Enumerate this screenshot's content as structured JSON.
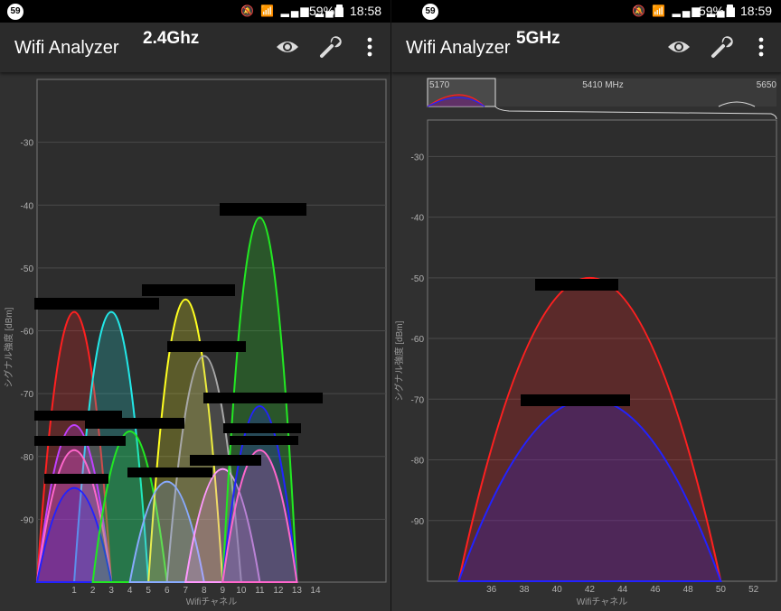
{
  "panels": [
    {
      "status": {
        "badge": "59",
        "battery": "59%",
        "time": "18:58"
      },
      "app_title": "Wifi Analyzer",
      "band_label": "2.4Ghz",
      "icons": [
        "eye-icon",
        "wrench-icon",
        "overflow-menu-icon"
      ]
    },
    {
      "status": {
        "badge": "59",
        "battery": "59%",
        "time": "18:59"
      },
      "app_title": "Wifi Analyzer",
      "band_label": "5GHz",
      "icons": [
        "eye-icon",
        "wrench-icon",
        "overflow-menu-icon"
      ],
      "freq_labels": [
        "5170",
        "5410 MHz",
        "5650"
      ]
    }
  ],
  "chart_data": [
    {
      "type": "area",
      "xlabel": "Wifiチャネル",
      "ylabel": "シグナル強度 [dBm]",
      "xlim": [
        -1,
        17.8
      ],
      "ylim": [
        -100,
        -20
      ],
      "x_ticks": [
        1,
        2,
        3,
        4,
        5,
        6,
        7,
        8,
        9,
        10,
        11,
        12,
        13,
        14
      ],
      "y_ticks": [
        -30,
        -40,
        -50,
        -60,
        -70,
        -80,
        -90
      ],
      "grid": true,
      "series": [
        {
          "center": 1,
          "peak": -57,
          "color": "#ff2020"
        },
        {
          "center": 3,
          "peak": -57,
          "color": "#22e8e8"
        },
        {
          "center": 1,
          "peak": -75,
          "color": "#c040ff"
        },
        {
          "center": 1,
          "peak": -79,
          "color": "#ff66cc"
        },
        {
          "center": 1,
          "peak": -85,
          "color": "#2222ff"
        },
        {
          "center": 4,
          "peak": -76,
          "color": "#22e822"
        },
        {
          "center": 7,
          "peak": -55,
          "color": "#ffff20"
        },
        {
          "center": 8,
          "peak": -64,
          "color": "#a8a8a8"
        },
        {
          "center": 6,
          "peak": -84,
          "color": "#88aaff"
        },
        {
          "center": 9,
          "peak": -82,
          "color": "#ff99ff"
        },
        {
          "center": 11,
          "peak": -42,
          "color": "#22e822"
        },
        {
          "center": 11,
          "peak": -72,
          "color": "#2222ff"
        },
        {
          "center": 11,
          "peak": -79,
          "color": "#ff66cc"
        }
      ]
    },
    {
      "type": "area",
      "xlabel": "Wifiチャネル",
      "ylabel": "シグナル強度 [dBm]",
      "xlim": [
        32.1,
        53.4
      ],
      "ylim": [
        -100,
        -24
      ],
      "x_ticks": [
        36,
        38,
        40,
        42,
        44,
        46,
        48,
        50,
        52
      ],
      "y_ticks": [
        -30,
        -40,
        -50,
        -60,
        -70,
        -80,
        -90
      ],
      "grid": true,
      "series": [
        {
          "center": 42,
          "peak": -50,
          "color": "#ff2020"
        },
        {
          "center": 42,
          "peak": -70,
          "color": "#2222ff"
        }
      ]
    }
  ]
}
